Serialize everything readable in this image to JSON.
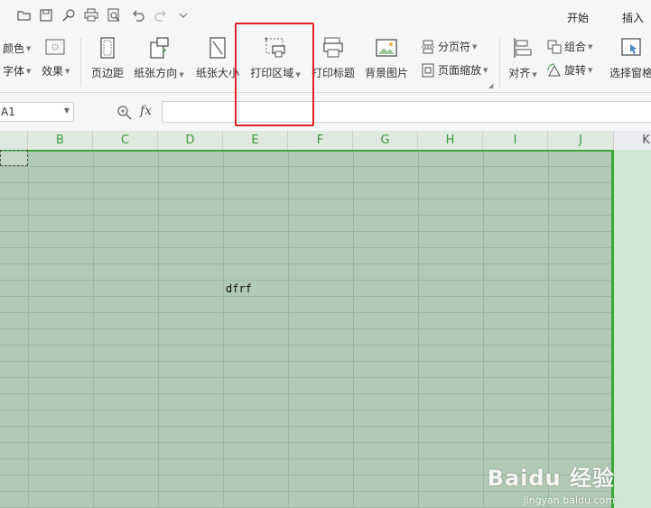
{
  "menu": {
    "tabs": [
      "开始",
      "插入"
    ]
  },
  "ribbon": {
    "color_label": "颜色",
    "font_label": "字体",
    "effects_label": "效果",
    "margin_label": "页边距",
    "orientation_label": "纸张方向",
    "size_label": "纸张大小",
    "print_area_label": "打印区域",
    "print_titles_label": "打印标题",
    "background_label": "背景图片",
    "page_break_label": "分页符",
    "page_zoom_label": "页面缩放",
    "align_label": "对齐",
    "group_label": "组合",
    "rotate_label": "旋转",
    "selection_pane_label": "选择窗格"
  },
  "formula_bar": {
    "name_box_value": "A1",
    "fx_label": "fx",
    "formula_value": ""
  },
  "grid": {
    "columns": [
      "B",
      "C",
      "D",
      "E",
      "F",
      "G",
      "H",
      "I",
      "J",
      "K"
    ],
    "cell_text": "dfrf"
  },
  "watermark": {
    "brand": "Baidu 经验",
    "url": "jingyan.baidu.com"
  },
  "colors": {
    "highlight": "#e02424",
    "print_area_border": "#3aa83a"
  }
}
